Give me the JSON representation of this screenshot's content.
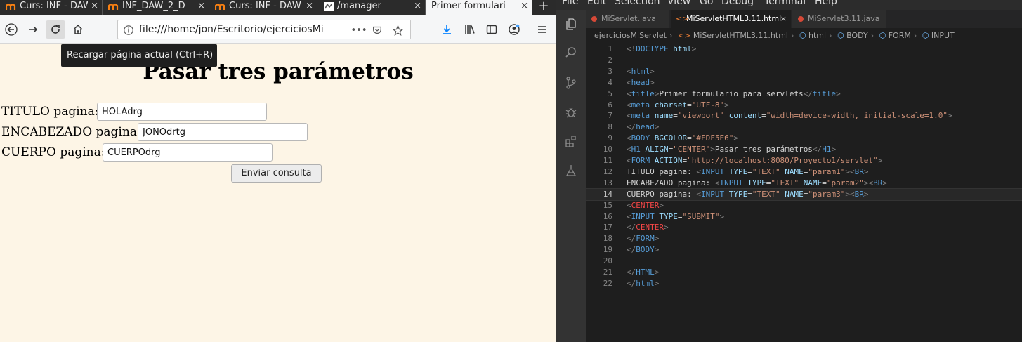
{
  "browser": {
    "tabs": [
      {
        "label": "Curs: INF - DAW"
      },
      {
        "label": "INF_DAW_2_D"
      },
      {
        "label": "Curs: INF - DAW"
      },
      {
        "label": "/manager"
      },
      {
        "label": "Primer formulari"
      }
    ],
    "tab_close": "×",
    "newtab_label": "+",
    "url": "file:///home/jon/Escritorio/ejerciciosMi",
    "url_more": "•••",
    "tooltip": "Recargar página actual (Ctrl+R)",
    "page": {
      "heading": "Pasar tres parámetros",
      "fields": [
        {
          "label": "TITULO pagina:",
          "value": "HOLAdrg"
        },
        {
          "label": "ENCABEZADO pagina:",
          "value": "JONOdrtg"
        },
        {
          "label": "CUERPO pagina:",
          "value": "CUERPOdrg"
        }
      ],
      "submit_label": "Enviar consulta",
      "background_color": "#FDF5E6"
    }
  },
  "editor": {
    "menu": [
      "File",
      "Edit",
      "Selection",
      "View",
      "Go",
      "Debug",
      "Terminal",
      "Help"
    ],
    "tabs": [
      {
        "label": "MiServlet.java",
        "kind": "java"
      },
      {
        "label": "MiServletHTML3.11.html",
        "kind": "html",
        "active": true
      },
      {
        "label": "MiServlet3.11.java",
        "kind": "java"
      }
    ],
    "tab_close": "×",
    "breadcrumb": [
      "ejerciciosMiServlet",
      "MiServletHTML3.11.html",
      "html",
      "BODY",
      "FORM",
      "INPUT"
    ],
    "lines": [
      {
        "n": "1",
        "segs": [
          [
            "b",
            "<!"
          ],
          [
            "tag",
            "DOCTYPE"
          ],
          [
            "attr",
            " html"
          ],
          [
            "b",
            ">"
          ]
        ]
      },
      {
        "n": "2",
        "segs": []
      },
      {
        "n": "3",
        "segs": [
          [
            "b",
            "<"
          ],
          [
            "tag",
            "html"
          ],
          [
            "b",
            ">"
          ]
        ]
      },
      {
        "n": "4",
        "segs": [
          [
            "b",
            "<"
          ],
          [
            "tag",
            "head"
          ],
          [
            "b",
            ">"
          ]
        ]
      },
      {
        "n": "5",
        "segs": [
          [
            "b",
            "<"
          ],
          [
            "tag",
            "title"
          ],
          [
            "b",
            ">"
          ],
          [
            "txt",
            "Primer formulario para servlets"
          ],
          [
            "b",
            "</"
          ],
          [
            "tag",
            "title"
          ],
          [
            "b",
            ">"
          ]
        ]
      },
      {
        "n": "6",
        "segs": [
          [
            "b",
            "<"
          ],
          [
            "tag",
            "meta"
          ],
          [
            "attr",
            " charset"
          ],
          [
            "txt",
            "="
          ],
          [
            "str",
            "\"UTF-8\""
          ],
          [
            "b",
            ">"
          ]
        ]
      },
      {
        "n": "7",
        "segs": [
          [
            "b",
            "<"
          ],
          [
            "tag",
            "meta"
          ],
          [
            "attr",
            " name"
          ],
          [
            "txt",
            "="
          ],
          [
            "str",
            "\"viewport\""
          ],
          [
            "attr",
            " content"
          ],
          [
            "txt",
            "="
          ],
          [
            "str",
            "\"width=device-width, initial-scale=1.0\""
          ],
          [
            "b",
            ">"
          ]
        ]
      },
      {
        "n": "8",
        "segs": [
          [
            "b",
            "</"
          ],
          [
            "tag",
            "head"
          ],
          [
            "b",
            ">"
          ]
        ]
      },
      {
        "n": "9",
        "segs": [
          [
            "b",
            "<"
          ],
          [
            "tag",
            "BODY"
          ],
          [
            "attr",
            " BGCOLOR"
          ],
          [
            "txt",
            "="
          ],
          [
            "str",
            "\"#FDF5E6\""
          ],
          [
            "b",
            ">"
          ]
        ]
      },
      {
        "n": "10",
        "segs": [
          [
            "b",
            "<"
          ],
          [
            "tag",
            "H1"
          ],
          [
            "attr",
            " ALIGN"
          ],
          [
            "txt",
            "="
          ],
          [
            "str",
            "\"CENTER\""
          ],
          [
            "b",
            ">"
          ],
          [
            "txt",
            "Pasar tres parámetros"
          ],
          [
            "b",
            "</"
          ],
          [
            "tag",
            "H1"
          ],
          [
            "b",
            ">"
          ]
        ]
      },
      {
        "n": "11",
        "segs": [
          [
            "b",
            "<"
          ],
          [
            "tag",
            "FORM"
          ],
          [
            "attr",
            " ACTION"
          ],
          [
            "txt",
            "="
          ],
          [
            "link",
            "\"http://localhost:8080/Proyecto1/servlet\""
          ],
          [
            "b",
            ">"
          ]
        ]
      },
      {
        "n": "12",
        "segs": [
          [
            "txt",
            "TITULO pagina: "
          ],
          [
            "b",
            "<"
          ],
          [
            "tag",
            "INPUT"
          ],
          [
            "attr",
            " TYPE"
          ],
          [
            "txt",
            "="
          ],
          [
            "str",
            "\"TEXT\""
          ],
          [
            "attr",
            " NAME"
          ],
          [
            "txt",
            "="
          ],
          [
            "str",
            "\"param1\""
          ],
          [
            "b",
            "><"
          ],
          [
            "tag",
            "BR"
          ],
          [
            "b",
            ">"
          ]
        ]
      },
      {
        "n": "13",
        "segs": [
          [
            "txt",
            "ENCABEZADO pagina: "
          ],
          [
            "b",
            "<"
          ],
          [
            "tag",
            "INPUT"
          ],
          [
            "attr",
            " TYPE"
          ],
          [
            "txt",
            "="
          ],
          [
            "str",
            "\"TEXT\""
          ],
          [
            "attr",
            " NAME"
          ],
          [
            "txt",
            "="
          ],
          [
            "str",
            "\"param2\""
          ],
          [
            "b",
            "><"
          ],
          [
            "tag",
            "BR"
          ],
          [
            "b",
            ">"
          ]
        ]
      },
      {
        "n": "14",
        "segs": [
          [
            "txt",
            "CUERPO pagina: "
          ],
          [
            "b",
            "<"
          ],
          [
            "tag",
            "INPUT"
          ],
          [
            "attr",
            " TYPE"
          ],
          [
            "txt",
            "="
          ],
          [
            "str",
            "\"TEXT\""
          ],
          [
            "attr",
            " NAME"
          ],
          [
            "txt",
            "="
          ],
          [
            "str",
            "\"param3\""
          ],
          [
            "b",
            "><"
          ],
          [
            "tag",
            "BR"
          ],
          [
            "b",
            ">"
          ]
        ],
        "current": true
      },
      {
        "n": "15",
        "segs": [
          [
            "b",
            "<"
          ],
          [
            "red",
            "CENTER"
          ],
          [
            "b",
            ">"
          ]
        ]
      },
      {
        "n": "16",
        "segs": [
          [
            "b",
            "<"
          ],
          [
            "tag",
            "INPUT"
          ],
          [
            "attr",
            " TYPE"
          ],
          [
            "txt",
            "="
          ],
          [
            "str",
            "\"SUBMIT\""
          ],
          [
            "b",
            ">"
          ]
        ]
      },
      {
        "n": "17",
        "segs": [
          [
            "b",
            "</"
          ],
          [
            "red",
            "CENTER"
          ],
          [
            "b",
            ">"
          ]
        ]
      },
      {
        "n": "18",
        "segs": [
          [
            "b",
            "</"
          ],
          [
            "tag",
            "FORM"
          ],
          [
            "b",
            ">"
          ]
        ]
      },
      {
        "n": "19",
        "segs": [
          [
            "b",
            "</"
          ],
          [
            "tag",
            "BODY"
          ],
          [
            "b",
            ">"
          ]
        ]
      },
      {
        "n": "20",
        "segs": []
      },
      {
        "n": "21",
        "segs": [
          [
            "b",
            "</"
          ],
          [
            "tag",
            "HTML"
          ],
          [
            "b",
            ">"
          ]
        ]
      },
      {
        "n": "22",
        "segs": [
          [
            "b",
            "</"
          ],
          [
            "tag",
            "html"
          ],
          [
            "b",
            ">"
          ]
        ]
      }
    ]
  }
}
